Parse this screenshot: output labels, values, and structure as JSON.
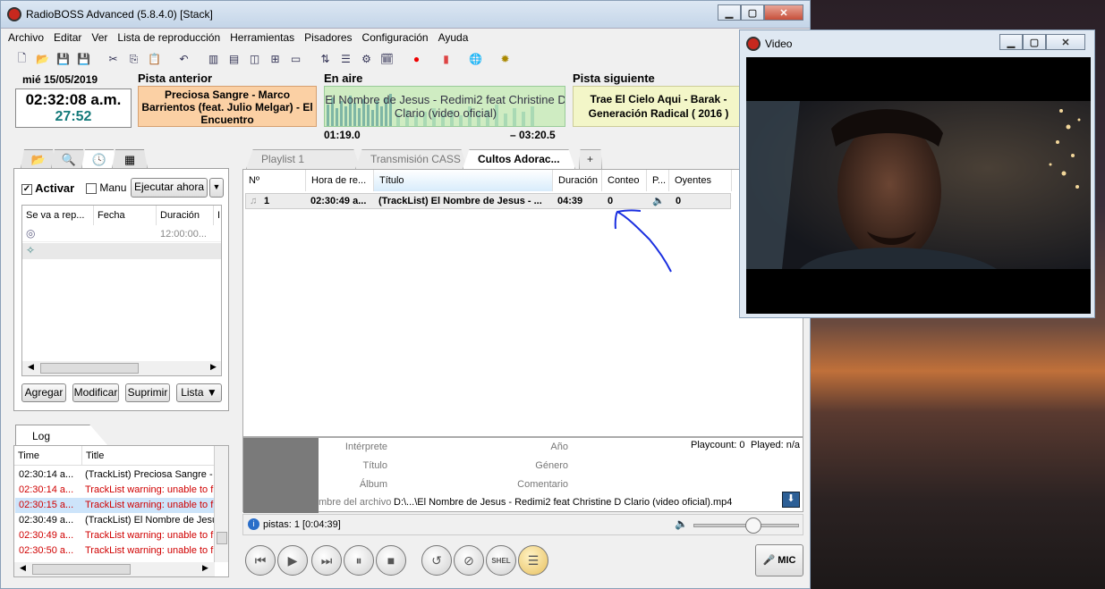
{
  "window": {
    "title": "RadioBOSS Advanced (5.8.4.0) [Stack]",
    "min": "▁",
    "max": "▢",
    "close": "✕"
  },
  "menu": [
    "Archivo",
    "Editar",
    "Ver",
    "Lista de reproducción",
    "Herramientas",
    "Pisadores",
    "Configuración",
    "Ayuda"
  ],
  "toolbar_icons": [
    "new-file-icon",
    "open-folder-icon",
    "save-icon",
    "save-as-icon",
    "cut-icon",
    "copy-icon",
    "paste-icon",
    "undo-icon",
    "layout-1-icon",
    "layout-2-icon",
    "layout-3-icon",
    "layout-4-icon",
    "layout-5-icon",
    "move-icon",
    "playlist-gen-icon",
    "options-icon",
    "schedule-icon",
    "record-icon",
    "stats-icon",
    "globe-icon",
    "plugin-icon"
  ],
  "info": {
    "date": "mié 15/05/2019",
    "time": "02:32:08 a.m.",
    "elapsed": "27:52",
    "prev_label": "Pista anterior",
    "prev_track": "Preciosa Sangre - Marco Barrientos (feat. Julio Melgar) - El Encuentro",
    "onair_label": "En aire",
    "onair_track": "El Nombre de Jesus - Redimi2 feat Christine D Clario (video oficial)",
    "pos_elapsed": "01:19.0",
    "pos_remaining": "– 03:20.5",
    "next_label": "Pista siguiente",
    "next_track": "Trae El Cielo Aqui - Barak - Generación Radical ( 2016 )"
  },
  "scheduler": {
    "activar": "Activar",
    "manual": "Manu",
    "run_now": "Ejecutar ahora",
    "dropdown": "▼",
    "columns": [
      "Se va a rep...",
      "Fecha",
      "Duración",
      "I"
    ],
    "row1_time": "12:00:00...",
    "buttons": {
      "add": "Agregar",
      "edit": "Modificar",
      "delete": "Suprimir",
      "list": "Lista ▼"
    }
  },
  "log": {
    "tab": "Log",
    "columns": [
      "Time",
      "Title"
    ],
    "rows": [
      {
        "time": "02:30:14 a...",
        "title": "(TrackList) Preciosa Sangre - I",
        "type": "normal"
      },
      {
        "time": "02:30:14 a...",
        "title": "TrackList warning: unable to f",
        "type": "red"
      },
      {
        "time": "02:30:15 a...",
        "title": "TrackList warning: unable to f",
        "type": "red-sel"
      },
      {
        "time": "02:30:49 a...",
        "title": "(TrackList) El Nombre de Jesu",
        "type": "normal"
      },
      {
        "time": "02:30:49 a...",
        "title": "TrackList warning: unable to f",
        "type": "red"
      },
      {
        "time": "02:30:50 a...",
        "title": "TrackList warning: unable to f",
        "type": "red"
      }
    ]
  },
  "playlist": {
    "tabs": [
      "Playlist 1",
      "Transmisión CASS",
      "Cultos Adorac..."
    ],
    "add_tab": "+",
    "columns": [
      "Nº",
      "Hora de re...",
      "Título",
      "Duración",
      "Conteo",
      "P...",
      "Oyentes"
    ],
    "row": {
      "num": "1",
      "time": "02:30:49 a...",
      "title": "(TrackList) El Nombre de Jesus - ...",
      "duration": "04:39",
      "count": "0",
      "listeners": "0"
    }
  },
  "track_info": {
    "labels": {
      "artist": "Intérprete",
      "title": "Título",
      "album": "Álbum",
      "year": "Año",
      "genre": "Género",
      "comment": "Comentario",
      "filename": "mbre del archivo"
    },
    "playcount": "Playcount: 0",
    "played": "Played: n/a",
    "filename_value": "D:\\...\\El Nombre de Jesus - Redimi2 feat Christine D Clario (video oficial).mp4"
  },
  "status": {
    "tracks": "pistas: 1 [0:04:39]"
  },
  "controls": {
    "mic": "MIC",
    "shel": "SHEL"
  },
  "video_window": {
    "title": "Video"
  }
}
